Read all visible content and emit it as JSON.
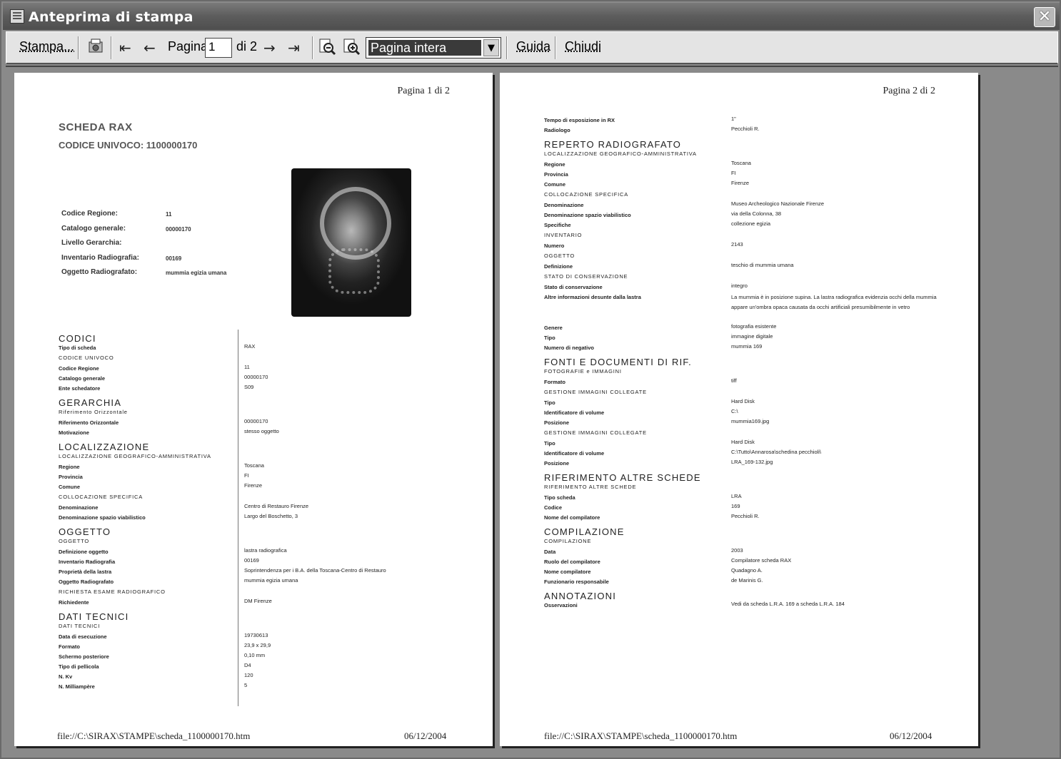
{
  "window": {
    "title": "Anteprima di stampa",
    "close_label": "✕"
  },
  "toolbar": {
    "print_label": "Stampa...",
    "page_label": "Pagina",
    "page_value": "1",
    "of_label": "di 2",
    "zoom_value": "Pagina intera",
    "help_label": "Guida",
    "close_label": "Chiudi"
  },
  "page1": {
    "page_number": "Pagina 1 di 2",
    "title": "SCHEDA RAX",
    "code": "CODICE UNIVOCO: 1100000170",
    "summary": [
      {
        "label": "Codice Regione:",
        "value": "11"
      },
      {
        "label": "Catalogo generale:",
        "value": "00000170"
      },
      {
        "label": "Livello Gerarchia:",
        "value": ""
      },
      {
        "label": "Inventario Radiografia:",
        "value": "00169"
      },
      {
        "label": "Oggetto Radiografato:",
        "value": "mummia egizia umana"
      }
    ],
    "rows": [
      {
        "t": "sec",
        "text": "CODICI"
      },
      {
        "t": "lbl",
        "text": "Tipo di scheda",
        "value": "RAX"
      },
      {
        "t": "sub",
        "text": "CODICE UNIVOCO"
      },
      {
        "t": "lbl",
        "text": "Codice Regione",
        "value": "11"
      },
      {
        "t": "lbl",
        "text": "Catalogo generale",
        "value": "00000170"
      },
      {
        "t": "lbl",
        "text": "Ente schedatore",
        "value": "S09"
      },
      {
        "t": "sec",
        "text": "GERARCHIA"
      },
      {
        "t": "sub",
        "text": "Riferimento Orizzontale"
      },
      {
        "t": "lbl",
        "text": "Riferimento Orizzontale",
        "value": "00000170"
      },
      {
        "t": "lbl",
        "text": "Motivazione",
        "value": "stesso oggetto"
      },
      {
        "t": "sec",
        "text": "LOCALIZZAZIONE"
      },
      {
        "t": "sub",
        "text": "LOCALIZZAZIONE GEOGRAFICO-AMMINISTRATIVA"
      },
      {
        "t": "lbl",
        "text": "Regione",
        "value": "Toscana"
      },
      {
        "t": "lbl",
        "text": "Provincia",
        "value": "FI"
      },
      {
        "t": "lbl",
        "text": "Comune",
        "value": "Firenze"
      },
      {
        "t": "sub",
        "text": "COLLOCAZIONE SPECIFICA"
      },
      {
        "t": "lbl",
        "text": "Denominazione",
        "value": "Centro di Restauro Firenze"
      },
      {
        "t": "lbl",
        "text": "Denominazione spazio viabilistico",
        "value": "Largo del Boschetto, 3"
      },
      {
        "t": "sec",
        "text": "OGGETTO"
      },
      {
        "t": "sub",
        "text": "OGGETTO"
      },
      {
        "t": "lbl",
        "text": "Definizione oggetto",
        "value": "lastra radiografica"
      },
      {
        "t": "lbl",
        "text": "Inventario Radiografia",
        "value": "00169"
      },
      {
        "t": "lbl",
        "text": "Proprietà della lastra",
        "value": "Soprintendenza per i B.A. della Toscana-Centro di Restauro"
      },
      {
        "t": "lbl",
        "text": "Oggetto Radiografato",
        "value": "mummia egizia umana"
      },
      {
        "t": "sub",
        "text": "RICHIESTA ESAME RADIOGRAFICO"
      },
      {
        "t": "lbl",
        "text": "Richiedente",
        "value": "DM Firenze"
      },
      {
        "t": "sec",
        "text": "DATI TECNICI"
      },
      {
        "t": "sub",
        "text": "DATI TECNICI"
      },
      {
        "t": "lbl",
        "text": "Data di esecuzione",
        "value": "19730613"
      },
      {
        "t": "lbl",
        "text": "Formato",
        "value": "23,9 x 29,9"
      },
      {
        "t": "lbl",
        "text": "Schermo posteriore",
        "value": "0,10 mm"
      },
      {
        "t": "lbl",
        "text": "Tipo di pellicola",
        "value": "D4"
      },
      {
        "t": "lbl",
        "text": "N. Kv",
        "value": "120"
      },
      {
        "t": "lbl",
        "text": "N. Milliampère",
        "value": "5"
      }
    ],
    "footer_left": "file://C:\\SIRAX\\STAMPE\\scheda_1100000170.htm",
    "footer_right": "06/12/2004"
  },
  "page2": {
    "page_number": "Pagina 2 di 2",
    "rows": [
      {
        "t": "lbl",
        "text": "Tempo di esposizione in RX",
        "value": "1\""
      },
      {
        "t": "lbl",
        "text": "Radiologo",
        "value": "Pecchioli R."
      },
      {
        "t": "sec",
        "text": "REPERTO RADIOGRAFATO"
      },
      {
        "t": "sub",
        "text": "LOCALIZZAZIONE GEOGRAFICO-AMMINISTRATIVA"
      },
      {
        "t": "lbl",
        "text": "Regione",
        "value": "Toscana"
      },
      {
        "t": "lbl",
        "text": "Provincia",
        "value": "FI"
      },
      {
        "t": "lbl",
        "text": "Comune",
        "value": "Firenze"
      },
      {
        "t": "sub",
        "text": "COLLOCAZIONE SPECIFICA"
      },
      {
        "t": "lbl",
        "text": "Denominazione",
        "value": "Museo Archeologico Nazionale Firenze"
      },
      {
        "t": "lbl",
        "text": "Denominazione spazio viabilistico",
        "value": "via della Colonna, 38"
      },
      {
        "t": "lbl",
        "text": "Specifiche",
        "value": "collezione egizia"
      },
      {
        "t": "sub",
        "text": "INVENTARIO"
      },
      {
        "t": "lbl",
        "text": "Numero",
        "value": "2143"
      },
      {
        "t": "sub",
        "text": "OGGETTO"
      },
      {
        "t": "lbl",
        "text": "Definizione",
        "value": "teschio di mummia umana"
      },
      {
        "t": "sub",
        "text": "STATO DI CONSERVAZIONE"
      },
      {
        "t": "lbl",
        "text": "Stato di conservazione",
        "value": "integro"
      },
      {
        "t": "lbl",
        "text": "Altre informazioni desunte dalla lastra",
        "value": "La mummia è in posizione supina. La lastra radiografica evidenzia occhi della mummia appare un'ombra opaca causata da occhi artificiali presumibilmente in vetro",
        "multi": true
      },
      {
        "t": "lbl",
        "text": "Genere",
        "value": "fotografia esistente"
      },
      {
        "t": "lbl",
        "text": "Tipo",
        "value": "immagine digitale"
      },
      {
        "t": "lbl",
        "text": "Numero di negativo",
        "value": "mummia 169"
      },
      {
        "t": "sec",
        "text": "FONTI E DOCUMENTI DI RIF."
      },
      {
        "t": "sub",
        "text": "FOTOGRAFIE e IMMAGINI"
      },
      {
        "t": "lbl",
        "text": "Formato",
        "value": "tiff"
      },
      {
        "t": "sub",
        "text": "GESTIONE IMMAGINI COLLEGATE"
      },
      {
        "t": "lbl",
        "text": "Tipo",
        "value": "Hard Disk"
      },
      {
        "t": "lbl",
        "text": "Identificatore di volume",
        "value": "C:\\"
      },
      {
        "t": "lbl",
        "text": "Posizione",
        "value": "mummia169.jpg"
      },
      {
        "t": "sub",
        "text": "GESTIONE IMMAGINI COLLEGATE"
      },
      {
        "t": "lbl",
        "text": "Tipo",
        "value": "Hard Disk"
      },
      {
        "t": "lbl",
        "text": "Identificatore di volume",
        "value": "C:\\Tutto\\Annarosa\\schedina pecchioli\\"
      },
      {
        "t": "lbl",
        "text": "Posizione",
        "value": "LRA_169-132.jpg"
      },
      {
        "t": "sec",
        "text": "RIFERIMENTO ALTRE SCHEDE"
      },
      {
        "t": "sub",
        "text": "RIFERIMENTO ALTRE SCHEDE"
      },
      {
        "t": "lbl",
        "text": "Tipo scheda",
        "value": "LRA"
      },
      {
        "t": "lbl",
        "text": "Codice",
        "value": "169"
      },
      {
        "t": "lbl",
        "text": "Nome del compilatore",
        "value": "Pecchioli R."
      },
      {
        "t": "sec",
        "text": "COMPILAZIONE"
      },
      {
        "t": "sub",
        "text": "COMPILAZIONE"
      },
      {
        "t": "lbl",
        "text": "Data",
        "value": "2003"
      },
      {
        "t": "lbl",
        "text": "Ruolo del compilatore",
        "value": "Compilatore scheda RAX"
      },
      {
        "t": "lbl",
        "text": "Nome compilatore",
        "value": "Quadagno A."
      },
      {
        "t": "lbl",
        "text": "Funzionario responsabile",
        "value": "de Marinis G."
      },
      {
        "t": "sec",
        "text": "ANNOTAZIONI"
      },
      {
        "t": "lbl",
        "text": "Osservazioni",
        "value": "Vedi da scheda L.R.A. 169 a scheda L.R.A. 184"
      }
    ],
    "footer_left": "file://C:\\SIRAX\\STAMPE\\scheda_1100000170.htm",
    "footer_right": "06/12/2004"
  }
}
